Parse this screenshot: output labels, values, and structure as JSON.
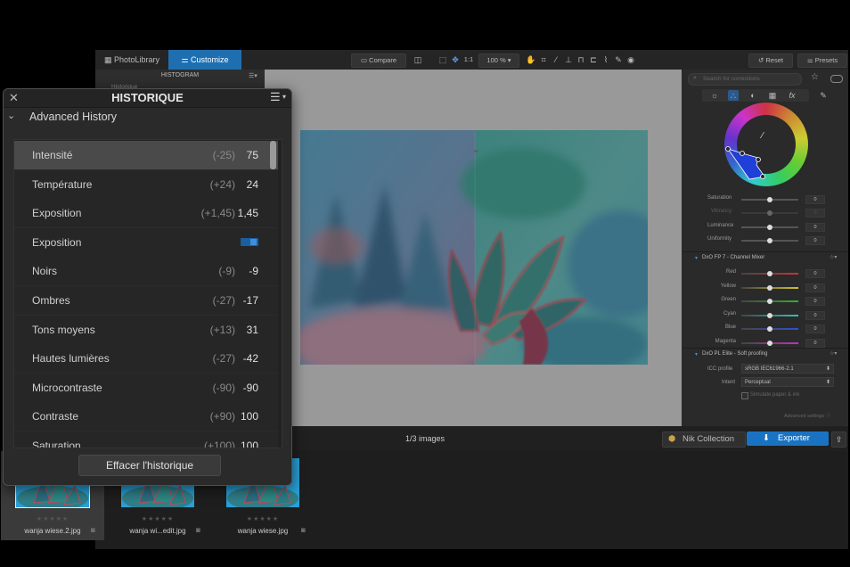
{
  "topbar": {
    "tabs": [
      {
        "label": "PhotoLibrary",
        "icon": "grid-icon"
      },
      {
        "label": "Customize",
        "icon": "sliders-icon",
        "active": true
      }
    ],
    "compare_label": "Compare",
    "zoom_1to1": "1:1",
    "zoom_percent": "100 %",
    "reset_label": "Reset",
    "presets_label": "Presets"
  },
  "left_panel": {
    "histogram_title": "HISTOGRAM",
    "history_label": "Historique"
  },
  "right_panel": {
    "search_placeholder": "Search for corrections",
    "color_sliders": [
      {
        "label": "Saturation",
        "value": "0"
      },
      {
        "label": "Vibrancy",
        "value": "0"
      },
      {
        "label": "Luminance",
        "value": "0"
      },
      {
        "label": "Uniformity",
        "value": "0"
      }
    ],
    "channel_mixer_title": "DxO FP 7 - Channel Mixer",
    "channel_mixer": [
      {
        "label": "Red",
        "color": "#d03030"
      },
      {
        "label": "Yellow",
        "color": "#d0c030"
      },
      {
        "label": "Green",
        "color": "#30b030"
      },
      {
        "label": "Cyan",
        "color": "#30c0c0"
      },
      {
        "label": "Blue",
        "color": "#3050d0"
      },
      {
        "label": "Magenta",
        "color": "#c030c0"
      }
    ],
    "softproof_title": "DxO PL Elite - Soft proofing",
    "icc_profile_label": "ICC profile",
    "icc_profile_value": "sRGB IEC61966-2.1",
    "intent_label": "Intent",
    "intent_value": "Perceptual",
    "simulate_label": "Simulate paper & ink",
    "advanced_settings": "Advanced settings"
  },
  "status": {
    "image_count": "1/3 images",
    "nik_label": "Nik Collection",
    "export_label": "Exporter"
  },
  "filmstrip": [
    {
      "name": "wanja wiese.2.jpg",
      "stars": "★★★★★",
      "selected": true
    },
    {
      "name": "wanja wi...edit.jpg",
      "stars": "★★★★★",
      "selected": false
    },
    {
      "name": "wanja wiese.jpg",
      "stars": "★★★★★",
      "selected": false
    }
  ],
  "history_window": {
    "title": "HISTORIQUE",
    "section_title": "Advanced History",
    "rows": [
      {
        "name": "Intensité",
        "old": "(-25)",
        "new": "75",
        "selected": true
      },
      {
        "name": "Température",
        "old": "(+24)",
        "new": "24"
      },
      {
        "name": "Exposition",
        "old": "(+1,45)",
        "new": "1,45"
      },
      {
        "name": "Exposition",
        "old": "",
        "new": "",
        "toggle": true
      },
      {
        "name": "Noirs",
        "old": "(-9)",
        "new": "-9"
      },
      {
        "name": "Ombres",
        "old": "(-27)",
        "new": "-17"
      },
      {
        "name": "Tons moyens",
        "old": "(+13)",
        "new": "31"
      },
      {
        "name": "Hautes lumières",
        "old": "(-27)",
        "new": "-42"
      },
      {
        "name": "Microcontraste",
        "old": "(-90)",
        "new": "-90"
      },
      {
        "name": "Contraste",
        "old": "(+90)",
        "new": "100"
      },
      {
        "name": "Saturation",
        "old": "(+100)",
        "new": "100"
      }
    ],
    "clear_button": "Effacer l'historique"
  }
}
